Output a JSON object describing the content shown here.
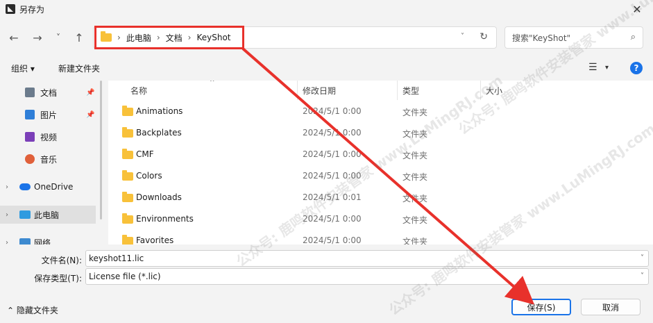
{
  "window": {
    "title": "另存为",
    "close": "✕"
  },
  "nav": {
    "back": "←",
    "forward": "→",
    "recent": "˅",
    "up": "↑"
  },
  "address": {
    "crumbs": [
      "此电脑",
      "文档",
      "KeyShot"
    ],
    "separator": "›",
    "dropdown": "˅",
    "refresh": "↻"
  },
  "search": {
    "placeholder": "搜索\"KeyShot\"",
    "icon": "⌕"
  },
  "toolbar": {
    "organize": "组织 ▾",
    "new_folder": "新建文件夹",
    "view": "☰",
    "view_caret": "▾",
    "help": "?"
  },
  "sidebar": {
    "items": [
      {
        "label": "文档",
        "icon": "document-icon",
        "pinned": true
      },
      {
        "label": "图片",
        "icon": "picture-icon",
        "pinned": true
      },
      {
        "label": "视频",
        "icon": "video-icon",
        "pinned": false
      },
      {
        "label": "音乐",
        "icon": "music-icon",
        "pinned": false
      },
      {
        "label": "OneDrive",
        "icon": "cloud-icon",
        "expand": "›"
      },
      {
        "label": "此电脑",
        "icon": "computer-icon",
        "expand": "›",
        "selected": true
      },
      {
        "label": "网络",
        "icon": "network-icon",
        "expand": "›"
      }
    ],
    "pin": "📌"
  },
  "columns": {
    "name": "名称",
    "date": "修改日期",
    "type": "类型",
    "size": "大小",
    "sort": "^"
  },
  "files": [
    {
      "name": "Animations",
      "date": "2024/5/1 0:00",
      "type": "文件夹"
    },
    {
      "name": "Backplates",
      "date": "2024/5/1 0:00",
      "type": "文件夹"
    },
    {
      "name": "CMF",
      "date": "2024/5/1 0:00",
      "type": "文件夹"
    },
    {
      "name": "Colors",
      "date": "2024/5/1 0:00",
      "type": "文件夹"
    },
    {
      "name": "Downloads",
      "date": "2024/5/1 0:01",
      "type": "文件夹"
    },
    {
      "name": "Environments",
      "date": "2024/5/1 0:00",
      "type": "文件夹"
    },
    {
      "name": "Favorites",
      "date": "2024/5/1 0:00",
      "type": "文件夹"
    }
  ],
  "save": {
    "filename_label": "文件名(N):",
    "filename": "keyshot11.lic",
    "type_label": "保存类型(T):",
    "type": "License file (*.lic)",
    "caret": "˅",
    "hide_folders": "⌃ 隐藏文件夹",
    "save_button": "保存(S)",
    "cancel_button": "取消"
  },
  "colors": {
    "accent": "#1a73e8",
    "annotation": "#e8312b",
    "folder": "#f8c13a"
  },
  "watermark": "公众号: 鹿鸣软件安装管家 www.LuMingRJ.com"
}
